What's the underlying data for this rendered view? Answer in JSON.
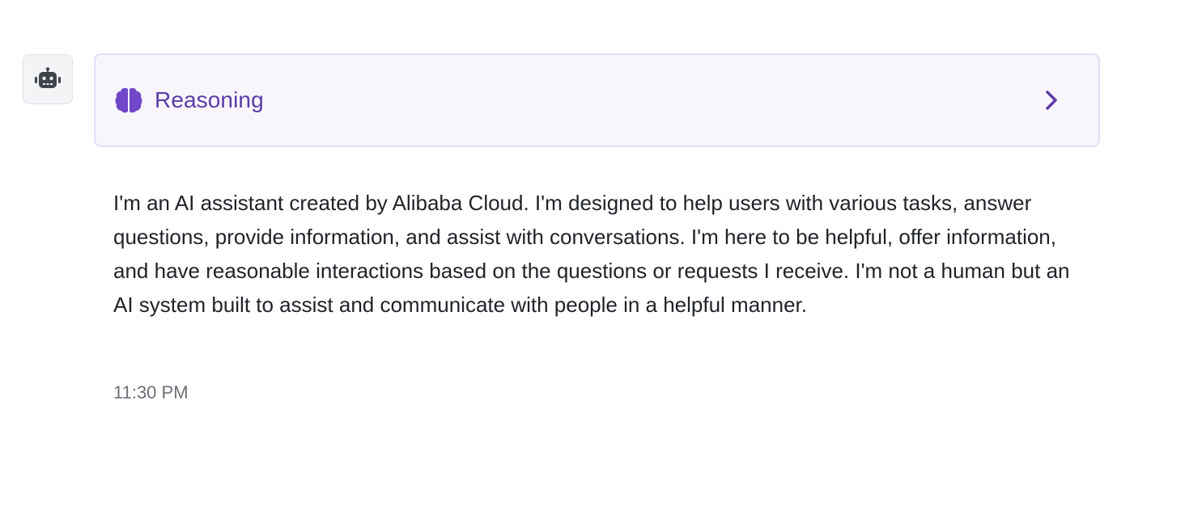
{
  "assistant": {
    "avatar_icon": "robot-icon"
  },
  "reasoning": {
    "icon": "brain-icon",
    "label": "Reasoning",
    "expand_icon": "chevron-right-icon",
    "accent_color": "#5b3ba6",
    "background_color": "#f8f5fd"
  },
  "message": {
    "text": "I'm an AI assistant created by Alibaba Cloud. I'm designed to help users with various tasks, answer questions, provide information, and assist with conversations. I'm here to be helpful, offer information, and have reasonable interactions based on the questions or requests I receive. I'm not a human but an AI system built to assist and communicate with people in a helpful manner.",
    "timestamp": "11:30 PM"
  }
}
